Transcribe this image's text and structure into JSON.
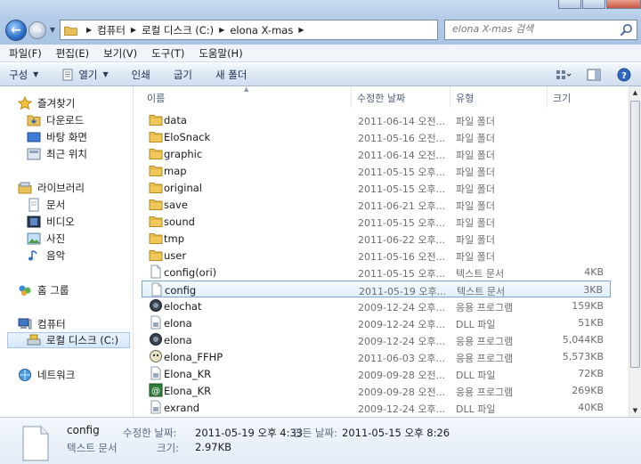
{
  "address": {
    "crumbs": [
      "컴퓨터",
      "로컬 디스크 (C:)",
      "elona X-mas"
    ]
  },
  "search": {
    "placeholder": "elona X-mas 검색"
  },
  "menu": [
    "파일(F)",
    "편집(E)",
    "보기(V)",
    "도구(T)",
    "도움말(H)"
  ],
  "toolbar": {
    "organize": "구성",
    "open": "열기",
    "print": "인쇄",
    "burn": "굽기",
    "new_folder": "새 폴더"
  },
  "sidebar": {
    "favorites": "즐겨찾기",
    "downloads": "다운로드",
    "desktop": "바탕 화면",
    "recent": "최근 위치",
    "libraries": "라이브러리",
    "documents": "문서",
    "videos": "비디오",
    "pictures": "사진",
    "music": "음악",
    "homegroup": "홈 그룹",
    "computer": "컴퓨터",
    "local_disk": "로컬 디스크 (C:)",
    "network": "네트워크"
  },
  "columns": {
    "name": "이름",
    "date": "수정한 날짜",
    "type": "유형",
    "size": "크기"
  },
  "files": [
    {
      "name": "data",
      "date": "2011-06-14 오전...",
      "type": "파일 폴더",
      "size": "",
      "icon": "folder"
    },
    {
      "name": "EloSnack",
      "date": "2011-05-16 오전...",
      "type": "파일 폴더",
      "size": "",
      "icon": "folder"
    },
    {
      "name": "graphic",
      "date": "2011-06-14 오전...",
      "type": "파일 폴더",
      "size": "",
      "icon": "folder"
    },
    {
      "name": "map",
      "date": "2011-05-15 오후...",
      "type": "파일 폴더",
      "size": "",
      "icon": "folder"
    },
    {
      "name": "original",
      "date": "2011-05-15 오후...",
      "type": "파일 폴더",
      "size": "",
      "icon": "folder"
    },
    {
      "name": "save",
      "date": "2011-06-21 오후...",
      "type": "파일 폴더",
      "size": "",
      "icon": "folder"
    },
    {
      "name": "sound",
      "date": "2011-05-15 오후...",
      "type": "파일 폴더",
      "size": "",
      "icon": "folder"
    },
    {
      "name": "tmp",
      "date": "2011-06-22 오후...",
      "type": "파일 폴더",
      "size": "",
      "icon": "folder"
    },
    {
      "name": "user",
      "date": "2011-05-16 오전...",
      "type": "파일 폴더",
      "size": "",
      "icon": "folder"
    },
    {
      "name": "config(ori)",
      "date": "2011-05-15 오후...",
      "type": "텍스트 문서",
      "size": "4KB",
      "icon": "text"
    },
    {
      "name": "config",
      "date": "2011-05-19 오후...",
      "type": "텍스트 문서",
      "size": "3KB",
      "icon": "text"
    },
    {
      "name": "elochat",
      "date": "2009-12-24 오후...",
      "type": "응용 프로그램",
      "size": "159KB",
      "icon": "app"
    },
    {
      "name": "elona",
      "date": "2009-12-24 오후...",
      "type": "DLL 파일",
      "size": "51KB",
      "icon": "dll"
    },
    {
      "name": "elona",
      "date": "2009-12-24 오후...",
      "type": "응용 프로그램",
      "size": "5,044KB",
      "icon": "app"
    },
    {
      "name": "elona_FFHP",
      "date": "2011-06-03 오후...",
      "type": "응용 프로그램",
      "size": "5,573KB",
      "icon": "app2"
    },
    {
      "name": "Elona_KR",
      "date": "2009-09-28 오전...",
      "type": "DLL 파일",
      "size": "72KB",
      "icon": "dll"
    },
    {
      "name": "Elona_KR",
      "date": "2009-09-28 오전...",
      "type": "응용 프로그램",
      "size": "269KB",
      "icon": "app3"
    },
    {
      "name": "exrand",
      "date": "2009-12-24 오후...",
      "type": "DLL 파일",
      "size": "40KB",
      "icon": "dll"
    }
  ],
  "selected_index": 10,
  "details": {
    "name": "config",
    "type": "텍스트 문서",
    "modified_label": "수정한 날짜:",
    "modified_value": "2011-05-19 오후 4:33",
    "created_label": "만든 날짜:",
    "created_value": "2011-05-15 오후 8:26",
    "size_label": "크기:",
    "size_value": "2.97KB"
  }
}
